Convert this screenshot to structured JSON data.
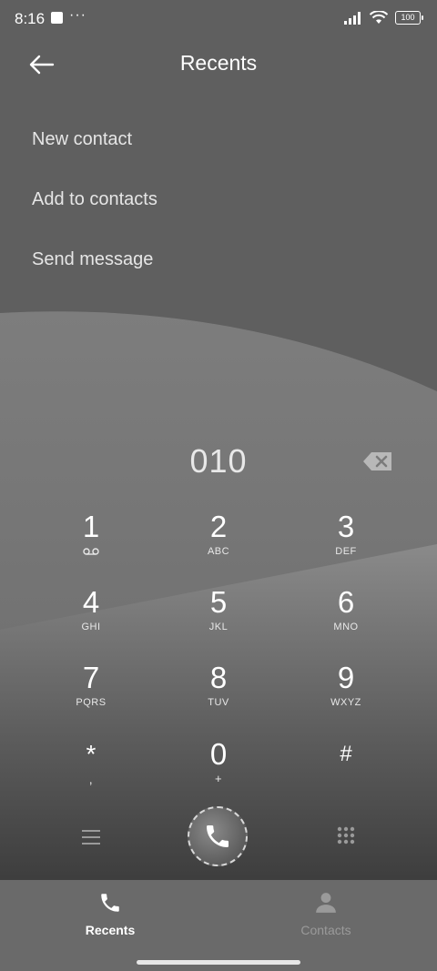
{
  "status": {
    "time": "8:16",
    "dots": "···",
    "battery": "100"
  },
  "header": {
    "title": "Recents"
  },
  "menu": [
    {
      "label": "New contact"
    },
    {
      "label": "Add to contacts"
    },
    {
      "label": "Send message"
    }
  ],
  "dialer": {
    "number": "010",
    "keys": [
      {
        "digit": "1",
        "letters": ""
      },
      {
        "digit": "2",
        "letters": "ABC"
      },
      {
        "digit": "3",
        "letters": "DEF"
      },
      {
        "digit": "4",
        "letters": "GHI"
      },
      {
        "digit": "5",
        "letters": "JKL"
      },
      {
        "digit": "6",
        "letters": "MNO"
      },
      {
        "digit": "7",
        "letters": "PQRS"
      },
      {
        "digit": "8",
        "letters": "TUV"
      },
      {
        "digit": "9",
        "letters": "WXYZ"
      },
      {
        "digit": "*",
        "letters": ","
      },
      {
        "digit": "0",
        "letters": "+"
      },
      {
        "digit": "#",
        "letters": ""
      }
    ]
  },
  "tabs": [
    {
      "label": "Recents",
      "active": true
    },
    {
      "label": "Contacts",
      "active": false
    }
  ],
  "colors": {
    "background": "#5f5f5f",
    "tab_bar": "#6a6a6a",
    "text": "#ffffff",
    "inactive_tab": "#9a9a9a"
  }
}
